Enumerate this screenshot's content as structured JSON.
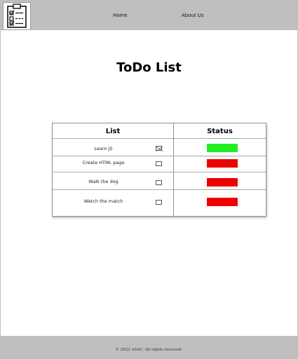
{
  "header": {
    "logo_icon": "clipboard-checklist-icon",
    "nav": {
      "home_label": "Home",
      "about_label": "About Us"
    }
  },
  "main": {
    "title": "ToDo List"
  },
  "table": {
    "headers": {
      "list": "List",
      "status": "Status"
    },
    "rows": [
      {
        "task": "Learn JS",
        "checked": true,
        "status_color": "#22ee22"
      },
      {
        "task": "Create HTML page",
        "checked": false,
        "status_color": "#ee0000"
      },
      {
        "task": "Walk the dog",
        "checked": false,
        "status_color": "#ee0000"
      },
      {
        "task": "Watch the match",
        "checked": false,
        "status_color": "#ee0000"
      }
    ]
  },
  "footer": {
    "copyright": "© 2022 ASAC.  All rights reserved."
  }
}
